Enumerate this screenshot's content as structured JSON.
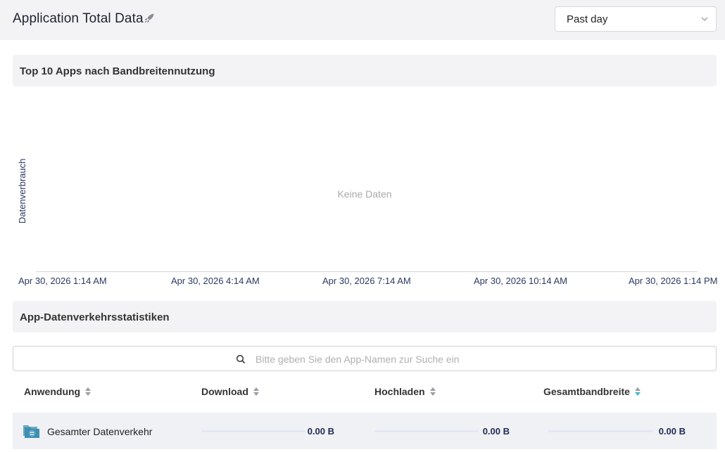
{
  "header": {
    "title": "Application Total Data",
    "title_icon": "rocket-icon",
    "range": {
      "selected": "Past day"
    }
  },
  "top_apps": {
    "heading": "Top 10 Apps nach Bandbreitennutzung",
    "empty_text": "Keine Daten",
    "chart_data": {
      "type": "line",
      "ylabel": "Datenverbrauch",
      "x_ticks": [
        "Apr 30, 2026 1:14 AM",
        "Apr 30, 2026 4:14 AM",
        "Apr 30, 2026 7:14 AM",
        "Apr 30, 2026 10:14 AM",
        "Apr 30, 2026 1:14 PM"
      ],
      "series": []
    }
  },
  "stats": {
    "heading": "App-Datenverkehrsstatistiken",
    "search_placeholder": "Bitte geben Sie den App-Namen zur Suche ein",
    "columns": [
      "Anwendung",
      "Download",
      "Hochladen",
      "Gesamtbandbreite"
    ],
    "active_sort_color": "#3fb5c7",
    "rows": [
      {
        "name": "Gesamter Datenverkehr",
        "icon": "folder-globe-icon",
        "download": "0.00 B",
        "upload": "0.00 B",
        "total": "0.00 B",
        "download_fraction": 0,
        "upload_fraction": 0,
        "total_fraction": 0
      }
    ]
  }
}
